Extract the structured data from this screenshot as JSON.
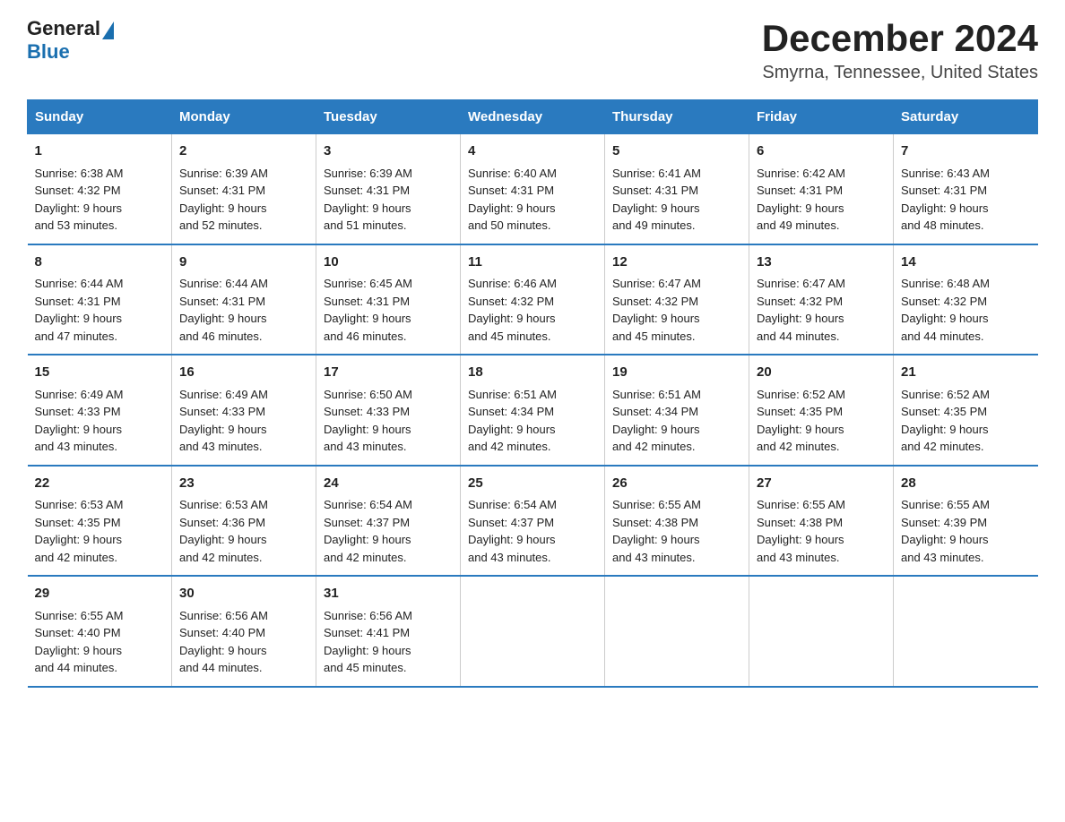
{
  "header": {
    "logo_general": "General",
    "logo_blue": "Blue",
    "month_title": "December 2024",
    "location": "Smyrna, Tennessee, United States"
  },
  "weekdays": [
    "Sunday",
    "Monday",
    "Tuesday",
    "Wednesday",
    "Thursday",
    "Friday",
    "Saturday"
  ],
  "weeks": [
    [
      {
        "day": "1",
        "sunrise": "6:38 AM",
        "sunset": "4:32 PM",
        "daylight": "9 hours and 53 minutes."
      },
      {
        "day": "2",
        "sunrise": "6:39 AM",
        "sunset": "4:31 PM",
        "daylight": "9 hours and 52 minutes."
      },
      {
        "day": "3",
        "sunrise": "6:39 AM",
        "sunset": "4:31 PM",
        "daylight": "9 hours and 51 minutes."
      },
      {
        "day": "4",
        "sunrise": "6:40 AM",
        "sunset": "4:31 PM",
        "daylight": "9 hours and 50 minutes."
      },
      {
        "day": "5",
        "sunrise": "6:41 AM",
        "sunset": "4:31 PM",
        "daylight": "9 hours and 49 minutes."
      },
      {
        "day": "6",
        "sunrise": "6:42 AM",
        "sunset": "4:31 PM",
        "daylight": "9 hours and 49 minutes."
      },
      {
        "day": "7",
        "sunrise": "6:43 AM",
        "sunset": "4:31 PM",
        "daylight": "9 hours and 48 minutes."
      }
    ],
    [
      {
        "day": "8",
        "sunrise": "6:44 AM",
        "sunset": "4:31 PM",
        "daylight": "9 hours and 47 minutes."
      },
      {
        "day": "9",
        "sunrise": "6:44 AM",
        "sunset": "4:31 PM",
        "daylight": "9 hours and 46 minutes."
      },
      {
        "day": "10",
        "sunrise": "6:45 AM",
        "sunset": "4:31 PM",
        "daylight": "9 hours and 46 minutes."
      },
      {
        "day": "11",
        "sunrise": "6:46 AM",
        "sunset": "4:32 PM",
        "daylight": "9 hours and 45 minutes."
      },
      {
        "day": "12",
        "sunrise": "6:47 AM",
        "sunset": "4:32 PM",
        "daylight": "9 hours and 45 minutes."
      },
      {
        "day": "13",
        "sunrise": "6:47 AM",
        "sunset": "4:32 PM",
        "daylight": "9 hours and 44 minutes."
      },
      {
        "day": "14",
        "sunrise": "6:48 AM",
        "sunset": "4:32 PM",
        "daylight": "9 hours and 44 minutes."
      }
    ],
    [
      {
        "day": "15",
        "sunrise": "6:49 AM",
        "sunset": "4:33 PM",
        "daylight": "9 hours and 43 minutes."
      },
      {
        "day": "16",
        "sunrise": "6:49 AM",
        "sunset": "4:33 PM",
        "daylight": "9 hours and 43 minutes."
      },
      {
        "day": "17",
        "sunrise": "6:50 AM",
        "sunset": "4:33 PM",
        "daylight": "9 hours and 43 minutes."
      },
      {
        "day": "18",
        "sunrise": "6:51 AM",
        "sunset": "4:34 PM",
        "daylight": "9 hours and 42 minutes."
      },
      {
        "day": "19",
        "sunrise": "6:51 AM",
        "sunset": "4:34 PM",
        "daylight": "9 hours and 42 minutes."
      },
      {
        "day": "20",
        "sunrise": "6:52 AM",
        "sunset": "4:35 PM",
        "daylight": "9 hours and 42 minutes."
      },
      {
        "day": "21",
        "sunrise": "6:52 AM",
        "sunset": "4:35 PM",
        "daylight": "9 hours and 42 minutes."
      }
    ],
    [
      {
        "day": "22",
        "sunrise": "6:53 AM",
        "sunset": "4:35 PM",
        "daylight": "9 hours and 42 minutes."
      },
      {
        "day": "23",
        "sunrise": "6:53 AM",
        "sunset": "4:36 PM",
        "daylight": "9 hours and 42 minutes."
      },
      {
        "day": "24",
        "sunrise": "6:54 AM",
        "sunset": "4:37 PM",
        "daylight": "9 hours and 42 minutes."
      },
      {
        "day": "25",
        "sunrise": "6:54 AM",
        "sunset": "4:37 PM",
        "daylight": "9 hours and 43 minutes."
      },
      {
        "day": "26",
        "sunrise": "6:55 AM",
        "sunset": "4:38 PM",
        "daylight": "9 hours and 43 minutes."
      },
      {
        "day": "27",
        "sunrise": "6:55 AM",
        "sunset": "4:38 PM",
        "daylight": "9 hours and 43 minutes."
      },
      {
        "day": "28",
        "sunrise": "6:55 AM",
        "sunset": "4:39 PM",
        "daylight": "9 hours and 43 minutes."
      }
    ],
    [
      {
        "day": "29",
        "sunrise": "6:55 AM",
        "sunset": "4:40 PM",
        "daylight": "9 hours and 44 minutes."
      },
      {
        "day": "30",
        "sunrise": "6:56 AM",
        "sunset": "4:40 PM",
        "daylight": "9 hours and 44 minutes."
      },
      {
        "day": "31",
        "sunrise": "6:56 AM",
        "sunset": "4:41 PM",
        "daylight": "9 hours and 45 minutes."
      },
      null,
      null,
      null,
      null
    ]
  ],
  "labels": {
    "sunrise": "Sunrise:",
    "sunset": "Sunset:",
    "daylight": "Daylight:"
  }
}
